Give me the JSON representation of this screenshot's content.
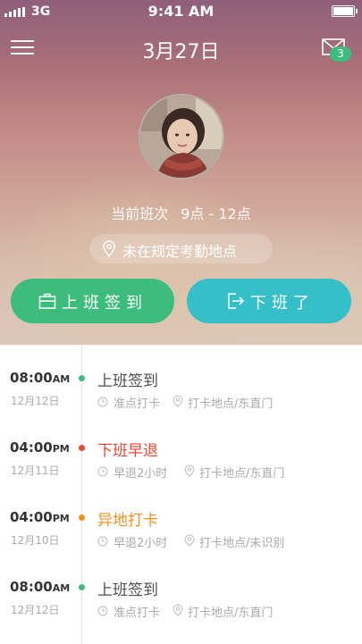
{
  "status_bar": {
    "carrier": "3G",
    "time": "9:41 AM"
  },
  "header": {
    "date": "3月27日",
    "mail_badge": "3"
  },
  "shift": {
    "label": "当前班次",
    "time": "9点 - 12点"
  },
  "location_status": "未在规定考勤地点",
  "buttons": {
    "check_in": "上班签到",
    "check_out": "下班了"
  },
  "colors": {
    "green": "#3dbd7d",
    "teal": "#35bfc9",
    "red": "#e84a33",
    "orange": "#f0901e",
    "gray_text": "#aaaaaa"
  },
  "records": [
    {
      "time": "08:00",
      "ampm": "AM",
      "date": "12月12日",
      "title": "上班签到",
      "status": "准点打卡",
      "location": "打卡地点/东直门",
      "color": "#4d4d4d",
      "dot": "#3dbd7d"
    },
    {
      "time": "04:00",
      "ampm": "PM",
      "date": "12月11日",
      "title": "下班早退",
      "status": "早退2小时",
      "location": "打卡地点/东直门",
      "color": "#e84a33",
      "dot": "#e84a33"
    },
    {
      "time": "04:00",
      "ampm": "PM",
      "date": "12月10日",
      "title": "异地打卡",
      "status": "早退2小时",
      "location": "打卡地点/未识别",
      "color": "#f0901e",
      "dot": "#f0901e"
    },
    {
      "time": "08:00",
      "ampm": "AM",
      "date": "12月12日",
      "title": "上班签到",
      "status": "准点打卡",
      "location": "打卡地点/东直门",
      "color": "#4d4d4d",
      "dot": "#3dbd7d"
    }
  ]
}
